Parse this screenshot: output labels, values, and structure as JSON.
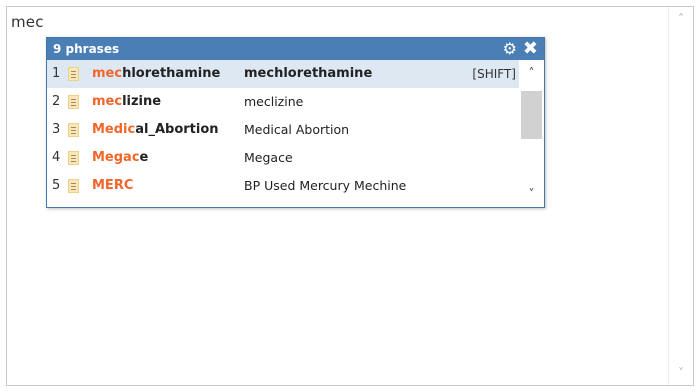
{
  "editor": {
    "text": "mec"
  },
  "popup": {
    "count_label": "9 phrases",
    "settings_icon": "gear-icon",
    "close_icon": "close-icon",
    "shortcut_hint": "[SHIFT]",
    "highlight_color": "#f0662b",
    "header_color": "#4a7fb5",
    "scroll_fraction": 0.11,
    "items": [
      {
        "num": "1",
        "match": "mec",
        "rest": "hlorethamine",
        "expansion": "mechlorethamine"
      },
      {
        "num": "2",
        "match": "mec",
        "rest": "lizine",
        "expansion": "meclizine"
      },
      {
        "num": "3",
        "match": "Medic",
        "rest": "al_Abortion",
        "expansion": "Medical Abortion"
      },
      {
        "num": "4",
        "match": "Megac",
        "rest": "e",
        "expansion": "Megace"
      },
      {
        "num": "5",
        "match": "MERC",
        "rest": "",
        "expansion": "BP Used Mercury Mechine"
      }
    ]
  }
}
